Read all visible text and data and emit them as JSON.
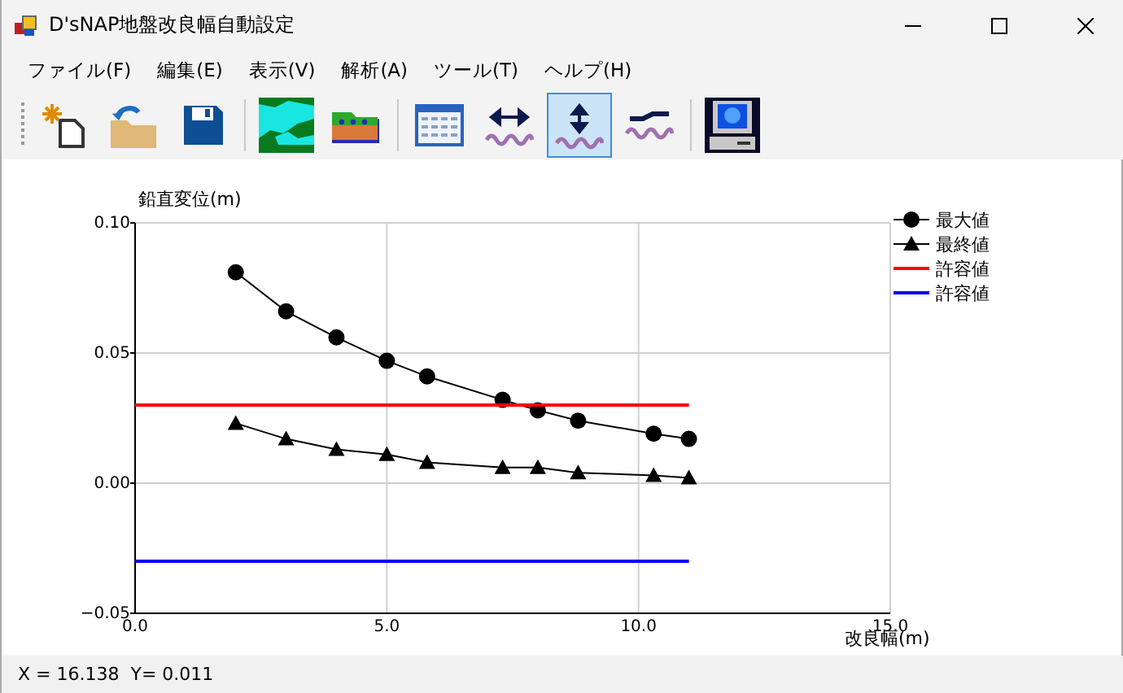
{
  "window": {
    "title": "D'sNAP地盤改良幅自動設定"
  },
  "menu": [
    "ファイル(F)",
    "編集(E)",
    "表示(V)",
    "解析(A)",
    "ツール(T)",
    "ヘルプ(H)"
  ],
  "toolbar": [
    {
      "kind": "new",
      "selected": false
    },
    {
      "kind": "open",
      "selected": false
    },
    {
      "kind": "save",
      "selected": false
    },
    {
      "kind": "sep"
    },
    {
      "kind": "map",
      "selected": false
    },
    {
      "kind": "layers",
      "selected": false
    },
    {
      "kind": "sep"
    },
    {
      "kind": "table",
      "selected": false
    },
    {
      "kind": "hwidth",
      "selected": false
    },
    {
      "kind": "vdisp",
      "selected": true
    },
    {
      "kind": "slope",
      "selected": false
    },
    {
      "kind": "sep"
    },
    {
      "kind": "computer",
      "selected": false
    }
  ],
  "chart": {
    "chart_data": {
      "type": "line",
      "xlabel": "改良幅(m)",
      "ylabel": "鉛直変位(m)",
      "x": [
        0,
        2,
        3,
        4,
        5,
        5.8,
        7.3,
        8,
        8.8,
        10.3,
        11
      ],
      "series": [
        {
          "name": "最大値",
          "color": "#000000",
          "marker": "circle",
          "values": [
            null,
            0.081,
            0.066,
            0.056,
            0.047,
            0.041,
            0.032,
            0.028,
            0.024,
            0.019,
            0.017
          ]
        },
        {
          "name": "最終値",
          "color": "#000000",
          "marker": "triangle",
          "values": [
            null,
            0.023,
            0.017,
            0.013,
            0.011,
            0.008,
            0.006,
            0.006,
            0.004,
            0.003,
            0.002
          ]
        },
        {
          "name": "許容値",
          "color": "#ff0000",
          "marker": "none",
          "values": [
            0.03,
            0.03,
            0.03,
            0.03,
            0.03,
            0.03,
            0.03,
            0.03,
            0.03,
            0.03,
            0.03
          ]
        },
        {
          "name": "許容値",
          "color": "#0000ff",
          "marker": "none",
          "values": [
            -0.03,
            -0.03,
            -0.03,
            -0.03,
            -0.03,
            -0.03,
            -0.03,
            -0.03,
            -0.03,
            -0.03,
            -0.03
          ]
        }
      ],
      "grid": true,
      "legend": "right",
      "xlim": [
        0,
        15
      ],
      "ylim": [
        -0.05,
        0.1
      ],
      "xticks": [
        {
          "value": 0,
          "label": "0.0"
        },
        {
          "value": 5,
          "label": "5.0"
        },
        {
          "value": 10,
          "label": "10.0"
        },
        {
          "value": 15,
          "label": "15.0"
        }
      ],
      "yticks": [
        {
          "value": -0.05,
          "label": "−0.05"
        },
        {
          "value": 0,
          "label": "0.00"
        },
        {
          "value": 0.05,
          "label": "0.05"
        },
        {
          "value": 0.1,
          "label": "0.10"
        }
      ]
    }
  },
  "status_bar": "X = 16.138  Y= 0.011"
}
